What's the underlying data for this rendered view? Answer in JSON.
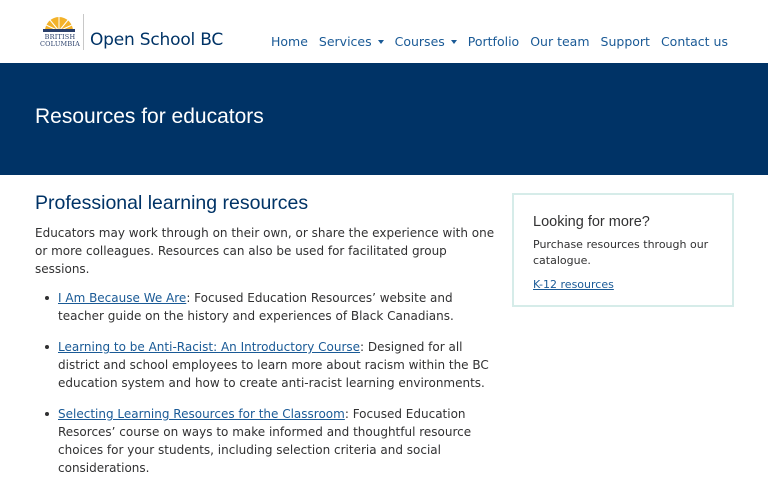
{
  "header": {
    "logo_text_line1": "BRITISH",
    "logo_text_line2": "COLUMBIA",
    "brand": "Open School BC",
    "nav": [
      {
        "label": "Home"
      },
      {
        "label": "Services",
        "dropdown": true
      },
      {
        "label": "Courses",
        "dropdown": true
      },
      {
        "label": "Portfolio"
      },
      {
        "label": "Our team"
      },
      {
        "label": "Support"
      },
      {
        "label": "Contact us"
      }
    ]
  },
  "banner": {
    "title": "Resources for educators"
  },
  "main": {
    "heading": "Professional learning resources",
    "intro": "Educators may work through on their own, or share the experience with one or more colleagues. Resources can also be used for facilitated group sessions.",
    "resources": [
      {
        "link": "I Am Because We Are",
        "desc": ": Focused Education Resources’ website and teacher guide on the history and experiences of Black Canadians."
      },
      {
        "link": "Learning to be Anti-Racist: An Introductory Course",
        "desc": ": Designed for all district and school employees to learn more about racism within the BC education system and how to create anti-racist learning environments."
      },
      {
        "link": "Selecting Learning Resources for the Classroom",
        "desc": ": Focused Education Resorces’ course on ways to make informed and thoughtful resource choices for your students, including selection criteria and social considerations."
      }
    ]
  },
  "aside": {
    "heading": "Looking for more?",
    "text": "Purchase resources through our catalogue.",
    "link": "K-12 resources"
  },
  "colors": {
    "brand_blue": "#003366",
    "link_blue": "#1a5a96",
    "sun_gold": "#f3b229",
    "aside_border": "#d6ece9"
  }
}
